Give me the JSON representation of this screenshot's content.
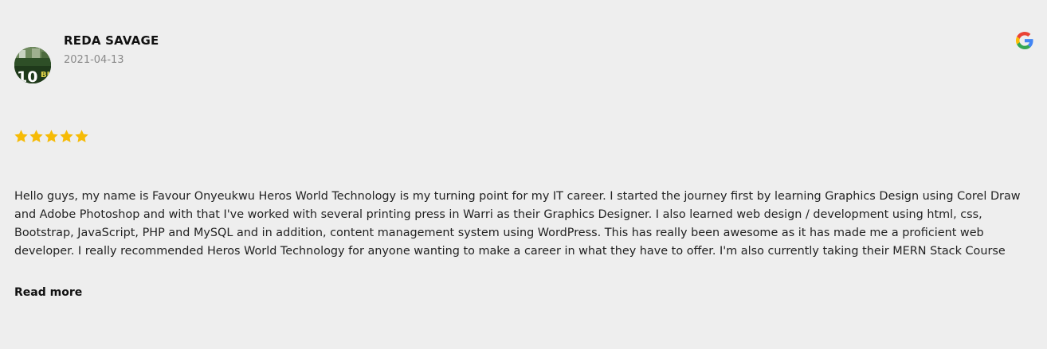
{
  "review": {
    "reviewer_name": "REDA SAVAGE",
    "date": "2021-04-13",
    "rating": 5,
    "rating_max": 5,
    "text": " Hello guys, my name is Favour Onyeukwu Heros World Technology is my turning point for my IT career. I started the journey first by learning Graphics Design using Corel Draw and Adobe Photoshop and with that I've worked with several printing press in Warri as their Graphics Designer. I also learned web design / development using html, css, Bootstrap, JavaScript, PHP and MySQL and in addition, content management system using WordPress. This has really been awesome as it has made me a proficient web developer. I really recommended Heros World Technology for anyone wanting to make a career in what they have to offer. I'm also currently taking their MERN Stack Course",
    "read_more_label": "Read more",
    "avatar_icon": "user-photo",
    "source_icon": "google-icon"
  },
  "colors": {
    "background": "#eeeeee",
    "star": "#f6bb06",
    "name": "#111111",
    "date": "#8a8a8a",
    "text": "#222222"
  }
}
